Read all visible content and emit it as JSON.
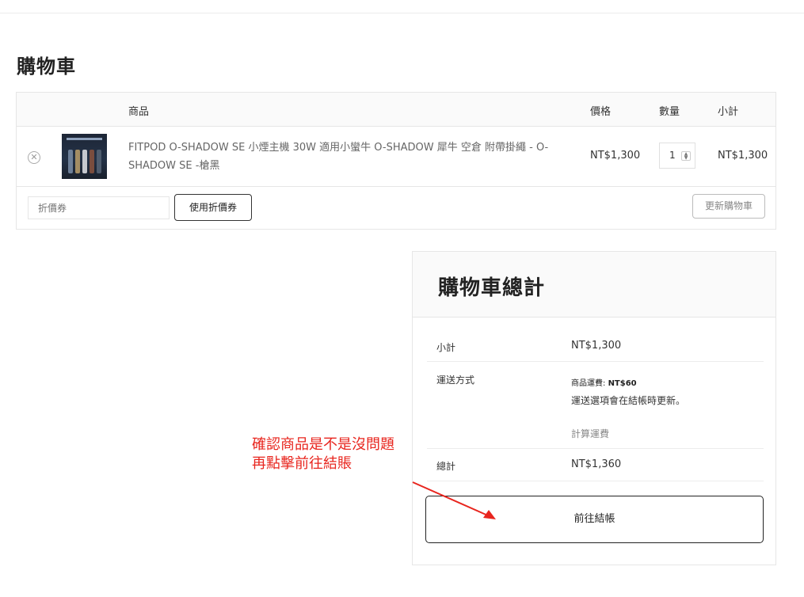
{
  "page": {
    "title": "購物車"
  },
  "cart_table": {
    "headers": {
      "product": "商品",
      "price": "價格",
      "quantity": "數量",
      "subtotal": "小計"
    },
    "items": [
      {
        "remove_icon": "close-circle-icon",
        "name": "FITPOD O-SHADOW SE 小煙主機 30W 適用小蠻牛 O-SHADOW 犀牛 空倉 附帶掛繩 - O-SHADOW SE -槍黑",
        "price": "NT$1,300",
        "quantity": "1",
        "subtotal": "NT$1,300"
      }
    ],
    "coupon_placeholder": "折價券",
    "apply_coupon_label": "使用折價券",
    "update_cart_label": "更新購物車"
  },
  "totals": {
    "title": "購物車總計",
    "subtotal_label": "小計",
    "subtotal_value": "NT$1,300",
    "shipping_label": "運送方式",
    "shipping_fee_label": "商品運費: ",
    "shipping_fee_value": "NT$60",
    "shipping_note": "運送選項會在結帳時更新。",
    "calc_shipping_label": "計算運費",
    "total_label": "總計",
    "total_value": "NT$1,360",
    "checkout_label": "前往結帳"
  },
  "annotation": {
    "line1": "確認商品是不是沒問題",
    "line2": "再點擊前往結賬",
    "color": "#e8251e"
  }
}
